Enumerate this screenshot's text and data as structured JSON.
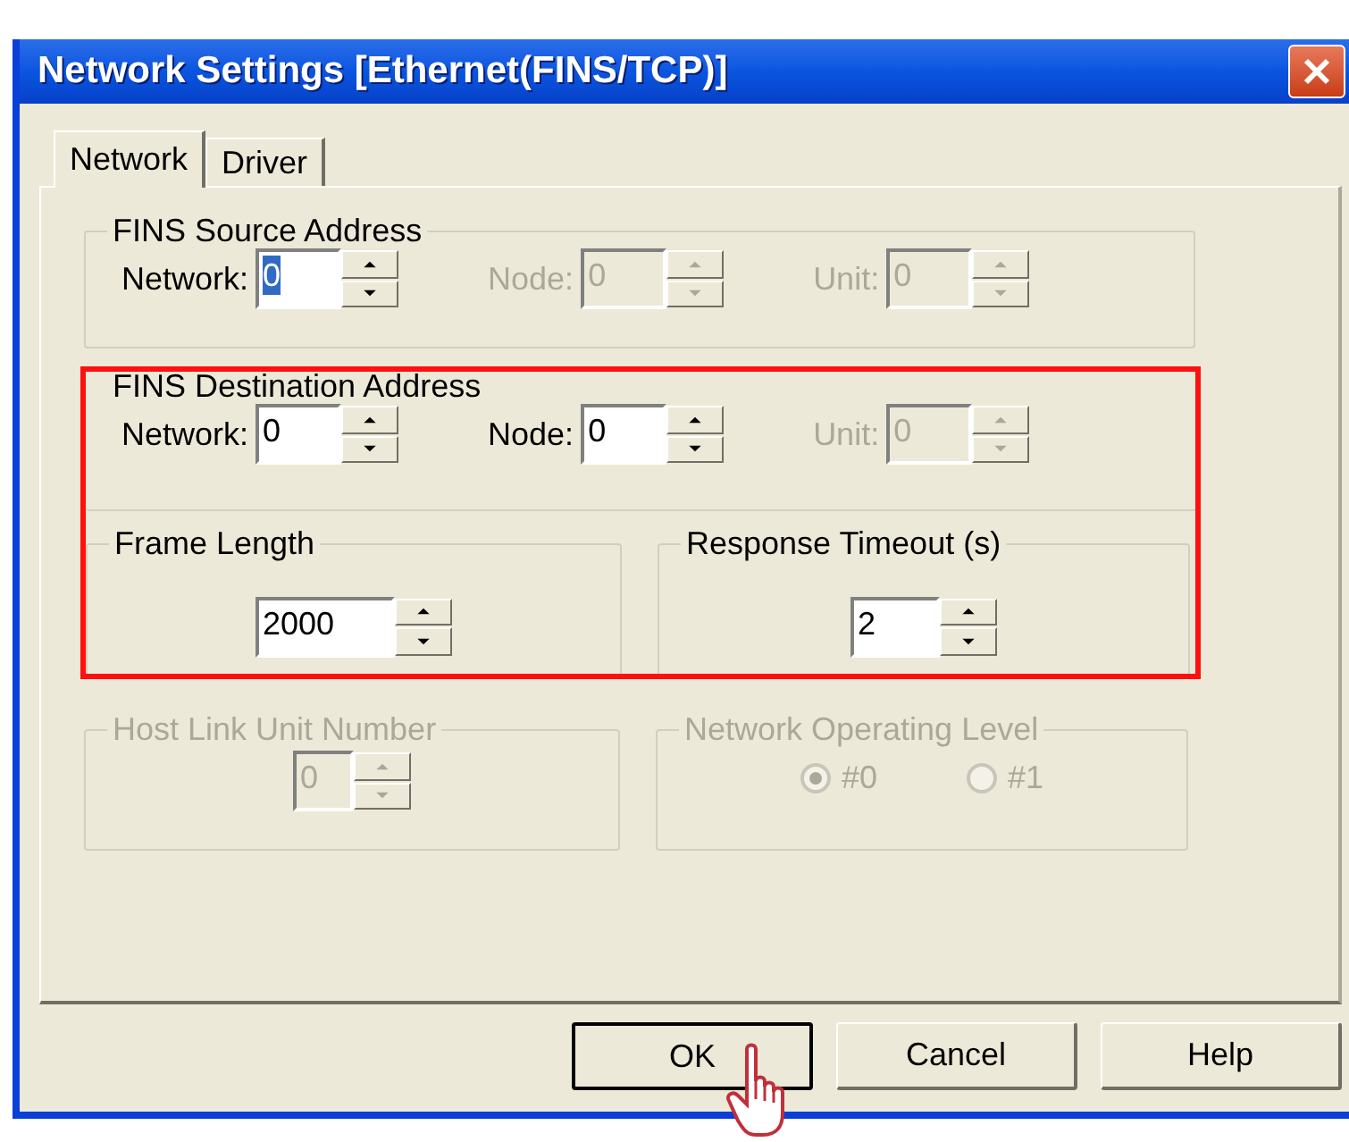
{
  "window": {
    "title": "Network Settings [Ethernet(FINS/TCP)]"
  },
  "tabs": [
    {
      "label": "Network",
      "selected": true
    },
    {
      "label": "Driver",
      "selected": false
    }
  ],
  "source_address": {
    "title": "FINS Source Address",
    "fields": [
      {
        "label": "Network:",
        "value": "0",
        "disabled": false,
        "text_selected": true
      },
      {
        "label": "Node:",
        "value": "0",
        "disabled": true,
        "text_selected": false
      },
      {
        "label": "Unit:",
        "value": "0",
        "disabled": true,
        "text_selected": false
      }
    ]
  },
  "highlighted_region": {
    "destination_address": {
      "title": "FINS Destination Address",
      "fields": [
        {
          "label": "Network:",
          "value": "0",
          "disabled": false,
          "text_selected": false
        },
        {
          "label": "Node:",
          "value": "0",
          "disabled": false,
          "text_selected": false
        },
        {
          "label": "Unit:",
          "value": "0",
          "disabled": true,
          "text_selected": false
        }
      ]
    },
    "frame_length": {
      "title": "Frame Length",
      "value": "2000",
      "disabled": false
    },
    "response_timeout": {
      "title": "Response Timeout (s)",
      "value": "2",
      "disabled": false
    }
  },
  "host_link_unit_number": {
    "title": "Host Link Unit Number",
    "value": "0",
    "disabled": true
  },
  "network_operating_level": {
    "title": "Network Operating Level",
    "disabled": true,
    "options": [
      {
        "label": "#0",
        "selected": true
      },
      {
        "label": "#1",
        "selected": false
      }
    ]
  },
  "buttons": [
    {
      "label": "OK",
      "default": true
    },
    {
      "label": "Cancel",
      "default": false
    },
    {
      "label": "Help",
      "default": false
    }
  ]
}
